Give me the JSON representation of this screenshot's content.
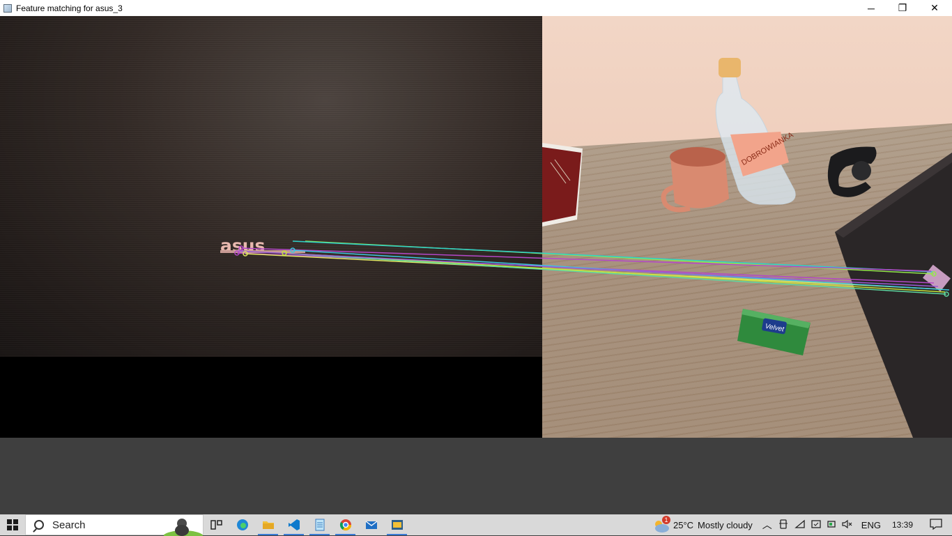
{
  "window": {
    "title": "Feature matching for asus_3",
    "controls": {
      "minimize": "─",
      "restore": "❐",
      "close": "✕"
    }
  },
  "image": {
    "left_label": "asus",
    "right_bottle_label": "DOBROWIANKA",
    "right_tissue_label": "Velvet"
  },
  "taskbar": {
    "search_placeholder": "Search",
    "pinned": [
      "task-view",
      "edge",
      "file-explorer",
      "vscode",
      "notepad",
      "chrome",
      "mail",
      "python"
    ],
    "weather": {
      "temp": "25°C",
      "condition": "Mostly cloudy",
      "badge": "1"
    },
    "language": "ENG",
    "time": "13:39"
  },
  "colors": {
    "taskbar_bg": "#d9d9d9",
    "background": "#3f3f3f",
    "active_indicator": "#3a7bd5"
  }
}
